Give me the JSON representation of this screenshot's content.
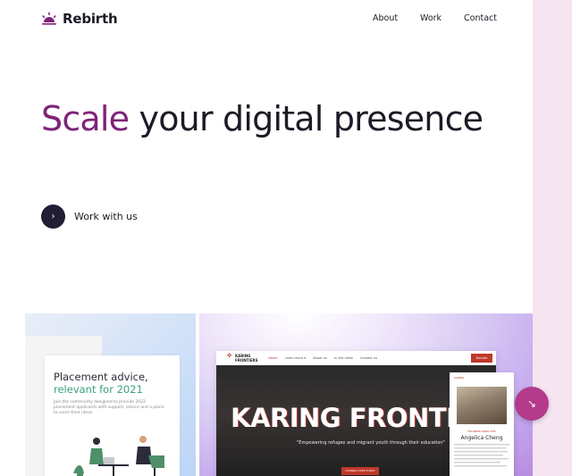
{
  "brand": {
    "name": "Rebirth",
    "icon": "sunrise-icon",
    "accent_color": "#7d2378"
  },
  "nav": {
    "items": [
      {
        "label": "About"
      },
      {
        "label": "Work"
      },
      {
        "label": "Contact"
      }
    ]
  },
  "hero": {
    "title_accent": "Scale",
    "title_rest": " your digital presence",
    "cta_label": "Work with us",
    "cta_icon": "chevron-right-icon"
  },
  "gallery": {
    "project_left": {
      "title_line1": "Placement advice,",
      "title_line2": "relevant for 2021",
      "body": "Join the community designed to provide 2022 placement applicants with support, advice and a place to voice their ideas."
    },
    "project_right": {
      "logo_line1": "KARING",
      "logo_line2": "FRONTIERS",
      "menu": [
        "Home",
        "Learn more ▾",
        "About us",
        "In the news",
        "Contact us"
      ],
      "donate_label": "Donate",
      "hero_title": "KARING FRONTIE",
      "hero_subtitle": "\"Empowering refugee and migrant youth through their education\"",
      "hero_button": "CHANGE LIVES TODAY",
      "profile": {
        "role": "FOUNDER DIRECTOR",
        "name": "Angelica Cheng"
      }
    }
  },
  "fab": {
    "icon": "arrow-down-right-icon",
    "color": "#b43a8b"
  }
}
